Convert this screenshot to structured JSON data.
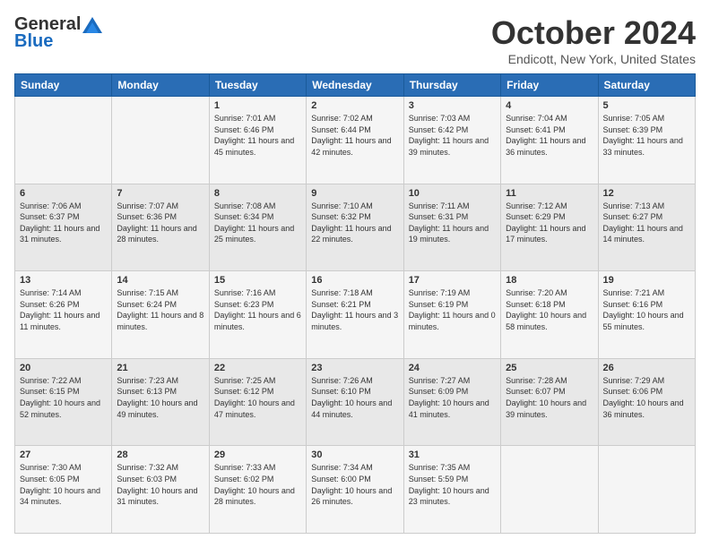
{
  "header": {
    "logo_general": "General",
    "logo_blue": "Blue",
    "month_title": "October 2024",
    "location": "Endicott, New York, United States"
  },
  "days_of_week": [
    "Sunday",
    "Monday",
    "Tuesday",
    "Wednesday",
    "Thursday",
    "Friday",
    "Saturday"
  ],
  "weeks": [
    [
      {
        "day": "",
        "sunrise": "",
        "sunset": "",
        "daylight": ""
      },
      {
        "day": "",
        "sunrise": "",
        "sunset": "",
        "daylight": ""
      },
      {
        "day": "1",
        "sunrise": "Sunrise: 7:01 AM",
        "sunset": "Sunset: 6:46 PM",
        "daylight": "Daylight: 11 hours and 45 minutes."
      },
      {
        "day": "2",
        "sunrise": "Sunrise: 7:02 AM",
        "sunset": "Sunset: 6:44 PM",
        "daylight": "Daylight: 11 hours and 42 minutes."
      },
      {
        "day": "3",
        "sunrise": "Sunrise: 7:03 AM",
        "sunset": "Sunset: 6:42 PM",
        "daylight": "Daylight: 11 hours and 39 minutes."
      },
      {
        "day": "4",
        "sunrise": "Sunrise: 7:04 AM",
        "sunset": "Sunset: 6:41 PM",
        "daylight": "Daylight: 11 hours and 36 minutes."
      },
      {
        "day": "5",
        "sunrise": "Sunrise: 7:05 AM",
        "sunset": "Sunset: 6:39 PM",
        "daylight": "Daylight: 11 hours and 33 minutes."
      }
    ],
    [
      {
        "day": "6",
        "sunrise": "Sunrise: 7:06 AM",
        "sunset": "Sunset: 6:37 PM",
        "daylight": "Daylight: 11 hours and 31 minutes."
      },
      {
        "day": "7",
        "sunrise": "Sunrise: 7:07 AM",
        "sunset": "Sunset: 6:36 PM",
        "daylight": "Daylight: 11 hours and 28 minutes."
      },
      {
        "day": "8",
        "sunrise": "Sunrise: 7:08 AM",
        "sunset": "Sunset: 6:34 PM",
        "daylight": "Daylight: 11 hours and 25 minutes."
      },
      {
        "day": "9",
        "sunrise": "Sunrise: 7:10 AM",
        "sunset": "Sunset: 6:32 PM",
        "daylight": "Daylight: 11 hours and 22 minutes."
      },
      {
        "day": "10",
        "sunrise": "Sunrise: 7:11 AM",
        "sunset": "Sunset: 6:31 PM",
        "daylight": "Daylight: 11 hours and 19 minutes."
      },
      {
        "day": "11",
        "sunrise": "Sunrise: 7:12 AM",
        "sunset": "Sunset: 6:29 PM",
        "daylight": "Daylight: 11 hours and 17 minutes."
      },
      {
        "day": "12",
        "sunrise": "Sunrise: 7:13 AM",
        "sunset": "Sunset: 6:27 PM",
        "daylight": "Daylight: 11 hours and 14 minutes."
      }
    ],
    [
      {
        "day": "13",
        "sunrise": "Sunrise: 7:14 AM",
        "sunset": "Sunset: 6:26 PM",
        "daylight": "Daylight: 11 hours and 11 minutes."
      },
      {
        "day": "14",
        "sunrise": "Sunrise: 7:15 AM",
        "sunset": "Sunset: 6:24 PM",
        "daylight": "Daylight: 11 hours and 8 minutes."
      },
      {
        "day": "15",
        "sunrise": "Sunrise: 7:16 AM",
        "sunset": "Sunset: 6:23 PM",
        "daylight": "Daylight: 11 hours and 6 minutes."
      },
      {
        "day": "16",
        "sunrise": "Sunrise: 7:18 AM",
        "sunset": "Sunset: 6:21 PM",
        "daylight": "Daylight: 11 hours and 3 minutes."
      },
      {
        "day": "17",
        "sunrise": "Sunrise: 7:19 AM",
        "sunset": "Sunset: 6:19 PM",
        "daylight": "Daylight: 11 hours and 0 minutes."
      },
      {
        "day": "18",
        "sunrise": "Sunrise: 7:20 AM",
        "sunset": "Sunset: 6:18 PM",
        "daylight": "Daylight: 10 hours and 58 minutes."
      },
      {
        "day": "19",
        "sunrise": "Sunrise: 7:21 AM",
        "sunset": "Sunset: 6:16 PM",
        "daylight": "Daylight: 10 hours and 55 minutes."
      }
    ],
    [
      {
        "day": "20",
        "sunrise": "Sunrise: 7:22 AM",
        "sunset": "Sunset: 6:15 PM",
        "daylight": "Daylight: 10 hours and 52 minutes."
      },
      {
        "day": "21",
        "sunrise": "Sunrise: 7:23 AM",
        "sunset": "Sunset: 6:13 PM",
        "daylight": "Daylight: 10 hours and 49 minutes."
      },
      {
        "day": "22",
        "sunrise": "Sunrise: 7:25 AM",
        "sunset": "Sunset: 6:12 PM",
        "daylight": "Daylight: 10 hours and 47 minutes."
      },
      {
        "day": "23",
        "sunrise": "Sunrise: 7:26 AM",
        "sunset": "Sunset: 6:10 PM",
        "daylight": "Daylight: 10 hours and 44 minutes."
      },
      {
        "day": "24",
        "sunrise": "Sunrise: 7:27 AM",
        "sunset": "Sunset: 6:09 PM",
        "daylight": "Daylight: 10 hours and 41 minutes."
      },
      {
        "day": "25",
        "sunrise": "Sunrise: 7:28 AM",
        "sunset": "Sunset: 6:07 PM",
        "daylight": "Daylight: 10 hours and 39 minutes."
      },
      {
        "day": "26",
        "sunrise": "Sunrise: 7:29 AM",
        "sunset": "Sunset: 6:06 PM",
        "daylight": "Daylight: 10 hours and 36 minutes."
      }
    ],
    [
      {
        "day": "27",
        "sunrise": "Sunrise: 7:30 AM",
        "sunset": "Sunset: 6:05 PM",
        "daylight": "Daylight: 10 hours and 34 minutes."
      },
      {
        "day": "28",
        "sunrise": "Sunrise: 7:32 AM",
        "sunset": "Sunset: 6:03 PM",
        "daylight": "Daylight: 10 hours and 31 minutes."
      },
      {
        "day": "29",
        "sunrise": "Sunrise: 7:33 AM",
        "sunset": "Sunset: 6:02 PM",
        "daylight": "Daylight: 10 hours and 28 minutes."
      },
      {
        "day": "30",
        "sunrise": "Sunrise: 7:34 AM",
        "sunset": "Sunset: 6:00 PM",
        "daylight": "Daylight: 10 hours and 26 minutes."
      },
      {
        "day": "31",
        "sunrise": "Sunrise: 7:35 AM",
        "sunset": "Sunset: 5:59 PM",
        "daylight": "Daylight: 10 hours and 23 minutes."
      },
      {
        "day": "",
        "sunrise": "",
        "sunset": "",
        "daylight": ""
      },
      {
        "day": "",
        "sunrise": "",
        "sunset": "",
        "daylight": ""
      }
    ]
  ]
}
